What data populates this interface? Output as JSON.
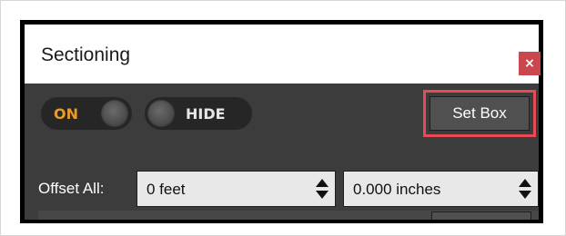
{
  "dialog": {
    "title": "Sectioning",
    "close_label": "×"
  },
  "toggles": {
    "on_label": "ON",
    "hide_label": "HIDE"
  },
  "toolbar": {
    "set_box_label": "Set Box"
  },
  "offset": {
    "label": "Offset All:",
    "feet_value": "0 feet",
    "inches_value": "0.000 inches"
  },
  "colors": {
    "close_button": "#c9474d",
    "highlight": "#e84b56",
    "on_accent": "#e79a2e",
    "panel": "#3c3c3c"
  }
}
